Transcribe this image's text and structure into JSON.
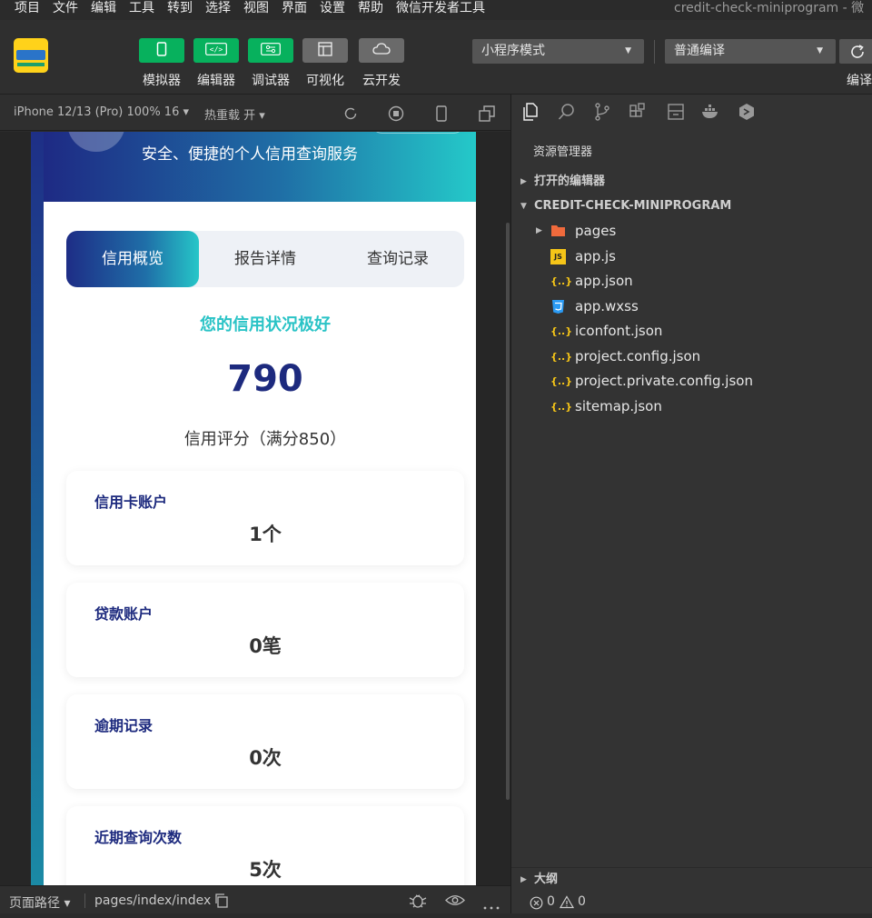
{
  "menubar": {
    "items": [
      "项目",
      "文件",
      "编辑",
      "工具",
      "转到",
      "选择",
      "视图",
      "界面",
      "设置",
      "帮助",
      "微信开发者工具"
    ],
    "window_title": "credit-check-miniprogram - 微"
  },
  "toolbar": {
    "buttons": [
      {
        "label": "模拟器",
        "icon": "phone-icon"
      },
      {
        "label": "编辑器",
        "icon": "code-icon"
      },
      {
        "label": "调试器",
        "icon": "debug-icon"
      },
      {
        "label": "可视化",
        "icon": "layout-icon"
      },
      {
        "label": "云开发",
        "icon": "cloud-icon"
      }
    ],
    "mode_select": "小程序模式",
    "compile_select": "普通编译",
    "compile_label": "编译"
  },
  "simulator": {
    "device": "iPhone 12/13 (Pro) 100% 16 ▾",
    "hot_reload": "热重载 开 ▾"
  },
  "app": {
    "banner_subtitle": "安全、便捷的个人信用查询服务",
    "tabs": [
      "信用概览",
      "报告详情",
      "查询记录"
    ],
    "status_text": "您的信用状况极好",
    "score": "790",
    "score_caption": "信用评分（满分850）",
    "stats": [
      {
        "title": "信用卡账户",
        "value": "1个"
      },
      {
        "title": "贷款账户",
        "value": "0笔"
      },
      {
        "title": "逾期记录",
        "value": "0次"
      },
      {
        "title": "近期查询次数",
        "value": "5次"
      }
    ]
  },
  "explorer": {
    "title": "资源管理器",
    "open_editors": "打开的编辑器",
    "project_name": "CREDIT-CHECK-MINIPROGRAM",
    "files": [
      {
        "name": "pages",
        "type": "folder"
      },
      {
        "name": "app.js",
        "type": "js"
      },
      {
        "name": "app.json",
        "type": "json"
      },
      {
        "name": "app.wxss",
        "type": "css"
      },
      {
        "name": "iconfont.json",
        "type": "json"
      },
      {
        "name": "project.config.json",
        "type": "json"
      },
      {
        "name": "project.private.config.json",
        "type": "json"
      },
      {
        "name": "sitemap.json",
        "type": "json"
      }
    ],
    "outline": "大纲",
    "errors": "0",
    "warnings": "0"
  },
  "statusbar": {
    "path_label": "页面路径 ▾",
    "path": "pages/index/index"
  },
  "colors": {
    "accent_green": "#07b15d",
    "brand_navy": "#1d2a7e",
    "brand_teal": "#2ac3c6"
  }
}
